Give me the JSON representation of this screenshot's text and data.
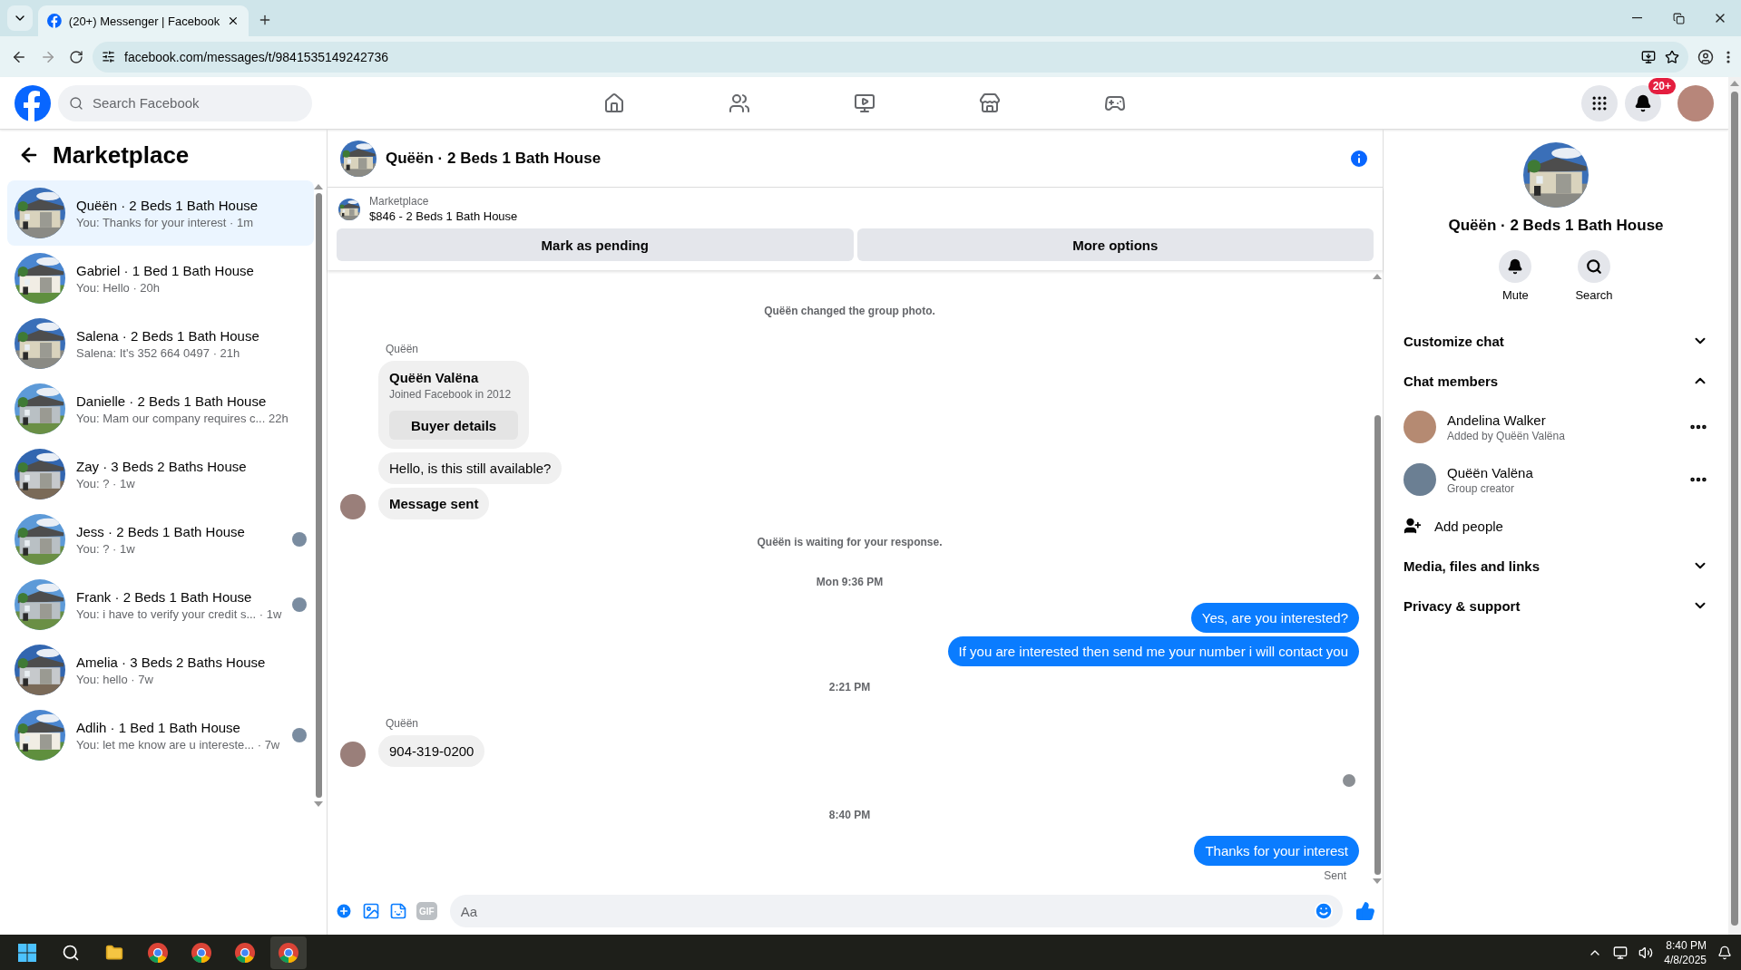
{
  "browser": {
    "tab_title": "(20+) Messenger | Facebook",
    "url": "facebook.com/messages/t/9841535149242736"
  },
  "header": {
    "search_placeholder": "Search Facebook",
    "notification_badge": "20+"
  },
  "sidebar": {
    "title": "Marketplace",
    "conversations": [
      {
        "title": "Quëën · 2 Beds 1 Bath House",
        "preview": "You: Thanks for your interest · 1m",
        "selected": true,
        "seen": false
      },
      {
        "title": "Gabriel · 1 Bed 1 Bath House",
        "preview": "You: Hello · 20h",
        "selected": false,
        "seen": false
      },
      {
        "title": "Salena · 2 Beds 1 Bath House",
        "preview": "Salena: It's 352 664 0497 · 21h",
        "selected": false,
        "seen": false
      },
      {
        "title": "Danielle · 2 Beds 1 Bath House",
        "preview": "You: Mam our company requires c...  22h",
        "selected": false,
        "seen": false
      },
      {
        "title": "Zay · 3 Beds 2 Baths House",
        "preview": "You: ? · 1w",
        "selected": false,
        "seen": false
      },
      {
        "title": "Jess · 2 Beds 1 Bath House",
        "preview": "You: ? · 1w",
        "selected": false,
        "seen": true
      },
      {
        "title": "Frank · 2 Beds 1 Bath House",
        "preview": "You: i have to verify your credit s... · 1w",
        "selected": false,
        "seen": true
      },
      {
        "title": "Amelia · 3 Beds 2 Baths House",
        "preview": "You: hello · 7w",
        "selected": false,
        "seen": false
      },
      {
        "title": "Adlih · 1 Bed 1 Bath House",
        "preview": "You: let me know are u intereste... · 7w",
        "selected": false,
        "seen": true
      }
    ]
  },
  "chat": {
    "title": "Quëën · 2 Beds 1 Bath House",
    "listing": {
      "label": "Marketplace",
      "price_title": "$846 - 2 Beds 1 Bath House",
      "buttons": [
        "Mark as pending",
        "More options"
      ]
    },
    "messages": [
      {
        "kind": "system",
        "text": "Quëën changed the group photo."
      },
      {
        "kind": "sender",
        "text": "Quëën"
      },
      {
        "kind": "card",
        "name": "Quëën Valëna",
        "subtitle": "Joined Facebook in 2012",
        "button": "Buyer details"
      },
      {
        "kind": "incoming",
        "text": "Hello, is this still available?",
        "bold": false,
        "avatar": false
      },
      {
        "kind": "incoming",
        "text": "Message sent",
        "bold": true,
        "avatar": true
      },
      {
        "kind": "system",
        "text": "Quëën is waiting for your response."
      },
      {
        "kind": "time",
        "text": "Mon 9:36 PM"
      },
      {
        "kind": "outgoing",
        "text": "Yes, are you interested?"
      },
      {
        "kind": "outgoing",
        "text": "If you are interested then send me your number i will contact you"
      },
      {
        "kind": "time",
        "text": "2:21 PM"
      },
      {
        "kind": "sender",
        "text": "Quëën"
      },
      {
        "kind": "incoming",
        "text": "904-319-0200",
        "bold": false,
        "avatar": true
      },
      {
        "kind": "receipt"
      },
      {
        "kind": "time",
        "text": "8:40 PM"
      },
      {
        "kind": "outgoing",
        "text": "Thanks for your interest"
      },
      {
        "kind": "status",
        "text": "Sent"
      }
    ],
    "composer": {
      "gif_label": "GIF",
      "placeholder": "Aa"
    }
  },
  "details": {
    "title": "Quëën · 2 Beds 1 Bath House",
    "actions": [
      {
        "label": "Mute",
        "kind": "mute"
      },
      {
        "label": "Search",
        "kind": "search"
      }
    ],
    "sections": [
      {
        "title": "Customize chat",
        "expanded": false
      },
      {
        "title": "Chat members",
        "expanded": true,
        "members": [
          {
            "name": "Andelina Walker",
            "subtitle": "Added by Quëën Valëna"
          },
          {
            "name": "Quëën Valëna",
            "subtitle": "Group creator"
          }
        ],
        "add_label": "Add people"
      },
      {
        "title": "Media, files and links",
        "expanded": false
      },
      {
        "title": "Privacy & support",
        "expanded": false
      }
    ]
  },
  "taskbar": {
    "time": "8:40 PM",
    "date": "4/8/2025"
  }
}
